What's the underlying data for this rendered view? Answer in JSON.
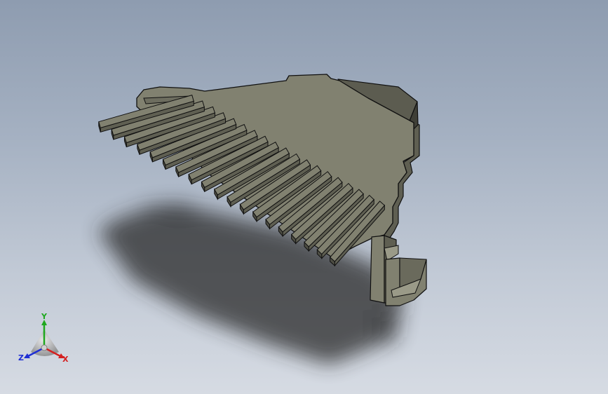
{
  "viewport": {
    "background_top": "#8e9cb0",
    "background_bottom": "#d6dbe3"
  },
  "model": {
    "face_color": "#818170",
    "side_color": "#5f5f52",
    "edge_color": "#101010",
    "shadow_color": "#2c2c2c",
    "tooth_count": 19
  },
  "triad": {
    "x_label": "X",
    "y_label": "Y",
    "z_label": "Z",
    "x_color": "#d42020",
    "y_color": "#1fa81f",
    "z_color": "#1f2fd4"
  }
}
